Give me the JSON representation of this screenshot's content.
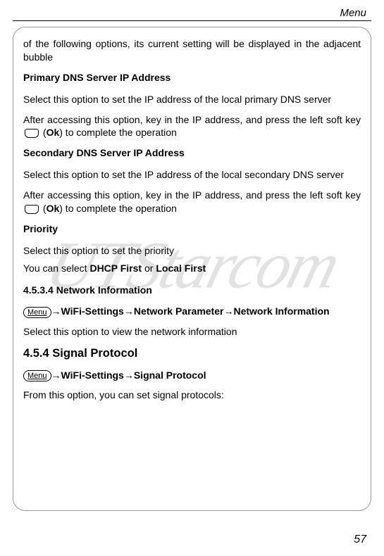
{
  "header": {
    "title": "Menu"
  },
  "watermark": "UTStarcom",
  "body": {
    "intro": "of the following options, its current setting will be displayed in the adjacent bubble",
    "primary_dns": {
      "heading": "Primary DNS Server IP Address",
      "p1": "Select this option to set the IP address of the local primary DNS server",
      "p2a": "After accessing this option, key in the IP address, and press the left soft key ",
      "p2b": " (",
      "ok": "Ok",
      "p2c": ") to complete the operation"
    },
    "secondary_dns": {
      "heading": "Secondary DNS Server IP Address",
      "p1": "Select this option to set the IP address of the local secondary DNS server",
      "p2a": "After accessing this option, key in the IP address, and press the left soft key ",
      "p2b": " (",
      "ok": "Ok",
      "p2c": ") to complete the operation"
    },
    "priority": {
      "heading": "Priority",
      "p1": "Select this option to set the priority",
      "p2a": "You can select ",
      "opt1": "DHCP First",
      "or": " or ",
      "opt2": "Local First"
    },
    "network_info": {
      "heading": "4.5.3.4 Network Information",
      "menu_label": "Menu",
      "path1": "WiFi-Settings",
      "path2": "Network Parameter",
      "path3": "Network Information",
      "arrow": "→",
      "p1": "Select this option to view the network information"
    },
    "signal_protocol": {
      "heading": "4.5.4 Signal Protocol",
      "menu_label": "Menu",
      "path1": "WiFi-Settings",
      "path2": "Signal Protocol",
      "arrow": "→",
      "p1": "From this option, you can set signal protocols:"
    }
  },
  "page_number": "57"
}
